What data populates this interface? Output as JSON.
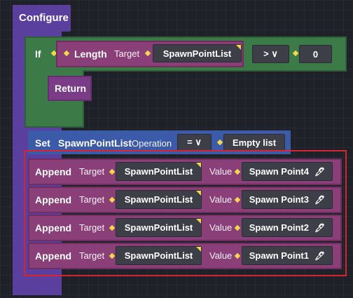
{
  "configure": {
    "label": "Configure"
  },
  "if_block": {
    "label": "If",
    "length": {
      "label": "Length",
      "target_label": "Target",
      "target_value": "SpawnPointList"
    },
    "operator": "> ∨",
    "compare_value": "0",
    "return_label": "Return"
  },
  "set_block": {
    "label": "Set",
    "variable": "SpawnPointList",
    "operation_label": "Operation",
    "operation_value": "= ∨",
    "value": "Empty list"
  },
  "append_rows": [
    {
      "label": "Append",
      "target_label": "Target",
      "target_value": "SpawnPointList",
      "value_label": "Value",
      "value": "Spawn Point4"
    },
    {
      "label": "Append",
      "target_label": "Target",
      "target_value": "SpawnPointList",
      "value_label": "Value",
      "value": "Spawn Point3"
    },
    {
      "label": "Append",
      "target_label": "Target",
      "target_value": "SpawnPointList",
      "value_label": "Value",
      "value": "Spawn Point2"
    },
    {
      "label": "Append",
      "target_label": "Target",
      "target_value": "SpawnPointList",
      "value_label": "Value",
      "value": "Spawn Point1"
    }
  ],
  "icons": {
    "picker": "eyedropper-icon",
    "connector": "diamond-connector-icon"
  },
  "colors": {
    "configure": "#5b3f9e",
    "if": "#3c7a48",
    "length": "#8a3f78",
    "set": "#3b5aa8",
    "append": "#8a3f78",
    "selection": "#d6252e"
  }
}
